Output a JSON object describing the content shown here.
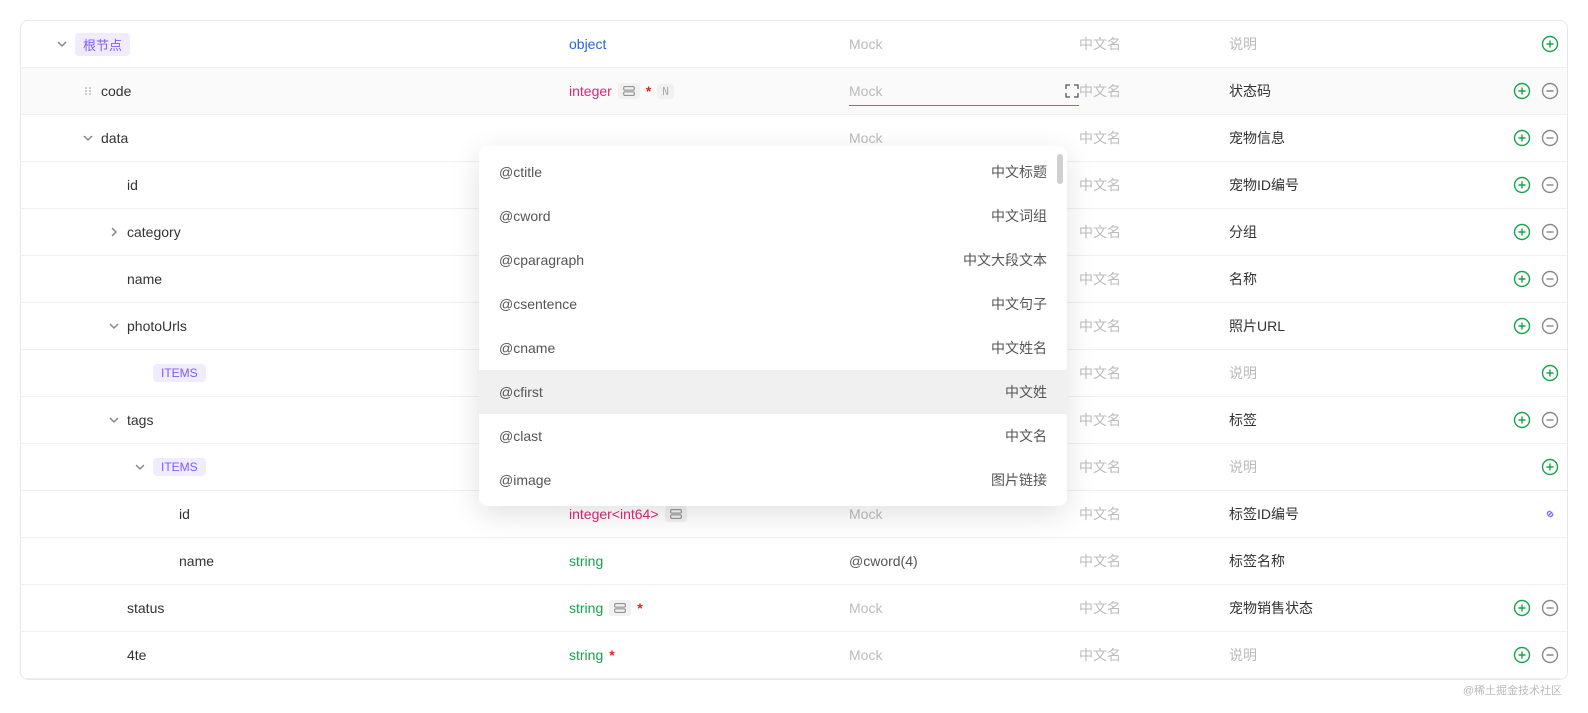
{
  "placeholders": {
    "mock": "Mock",
    "cn": "中文名",
    "desc": "说明"
  },
  "root_label": "根节点",
  "items_label": "ITEMS",
  "types": {
    "object": "object",
    "integer": "integer",
    "integer_int64": "integer<int64>",
    "string": "string"
  },
  "rows": [
    {
      "kind": "root",
      "indent": 0,
      "toggle": "down",
      "type": "object",
      "mock": "",
      "cn": "",
      "desc": "",
      "add": true,
      "remove": false
    },
    {
      "kind": "field",
      "name": "code",
      "indent": 1,
      "drag": true,
      "type": "integer",
      "combine": true,
      "required": true,
      "nullable": true,
      "mock_input": true,
      "cn": "",
      "desc": "状态码",
      "add": true,
      "remove": true,
      "highlighted": true
    },
    {
      "kind": "field",
      "name": "data",
      "indent": 1,
      "toggle": "down",
      "type": "",
      "mock": "",
      "cn": "",
      "desc": "宠物信息",
      "add": true,
      "remove": true
    },
    {
      "kind": "field",
      "name": "id",
      "indent": 2,
      "type": "",
      "mock": "",
      "cn": "",
      "desc": "宠物ID编号",
      "add": true,
      "remove": true
    },
    {
      "kind": "field",
      "name": "category",
      "indent": 2,
      "toggle": "right",
      "type": "",
      "mock": "",
      "cn": "",
      "desc": "分组",
      "add": true,
      "remove": true
    },
    {
      "kind": "field",
      "name": "name",
      "indent": 2,
      "type": "",
      "mock": "",
      "cn": "",
      "desc": "名称",
      "add": true,
      "remove": true
    },
    {
      "kind": "field",
      "name": "photoUrls",
      "indent": 2,
      "toggle": "down",
      "type": "",
      "mock": "",
      "cn": "",
      "desc": "照片URL",
      "add": true,
      "remove": true
    },
    {
      "kind": "items",
      "indent": 3,
      "type": "",
      "mock": "",
      "cn": "",
      "desc": "",
      "add": true,
      "remove": false
    },
    {
      "kind": "field",
      "name": "tags",
      "indent": 2,
      "toggle": "down",
      "type": "",
      "mock": "",
      "cn": "",
      "desc": "标签",
      "add": true,
      "remove": true
    },
    {
      "kind": "items",
      "indent": 3,
      "toggle": "down",
      "type": "",
      "mock": "",
      "cn": "",
      "desc": "",
      "add": true,
      "remove": false
    },
    {
      "kind": "field",
      "name": "id",
      "indent": 4,
      "type": "integer_int64",
      "combine": true,
      "mock": "",
      "cn": "",
      "desc": "标签ID编号",
      "link": true
    },
    {
      "kind": "field",
      "name": "name",
      "indent": 4,
      "type": "string",
      "mock_value": "@cword(4)",
      "cn": "",
      "desc": "标签名称"
    },
    {
      "kind": "field",
      "name": "status",
      "indent": 2,
      "type": "string",
      "combine": true,
      "required": true,
      "mock": "",
      "cn": "",
      "desc": "宠物销售状态",
      "add": true,
      "remove": true
    },
    {
      "kind": "field",
      "name": "4te",
      "indent": 2,
      "type": "string",
      "required": true,
      "mock": "",
      "cn": "",
      "desc": "",
      "add": true,
      "remove": true
    }
  ],
  "dropdown": {
    "items": [
      {
        "key": "@ctitle",
        "label": "中文标题"
      },
      {
        "key": "@cword",
        "label": "中文词组"
      },
      {
        "key": "@cparagraph",
        "label": "中文大段文本"
      },
      {
        "key": "@csentence",
        "label": "中文句子"
      },
      {
        "key": "@cname",
        "label": "中文姓名"
      },
      {
        "key": "@cfirst",
        "label": "中文姓",
        "hovered": true
      },
      {
        "key": "@clast",
        "label": "中文名"
      },
      {
        "key": "@image",
        "label": "图片链接"
      }
    ]
  },
  "watermark": "@稀土掘金技术社区"
}
